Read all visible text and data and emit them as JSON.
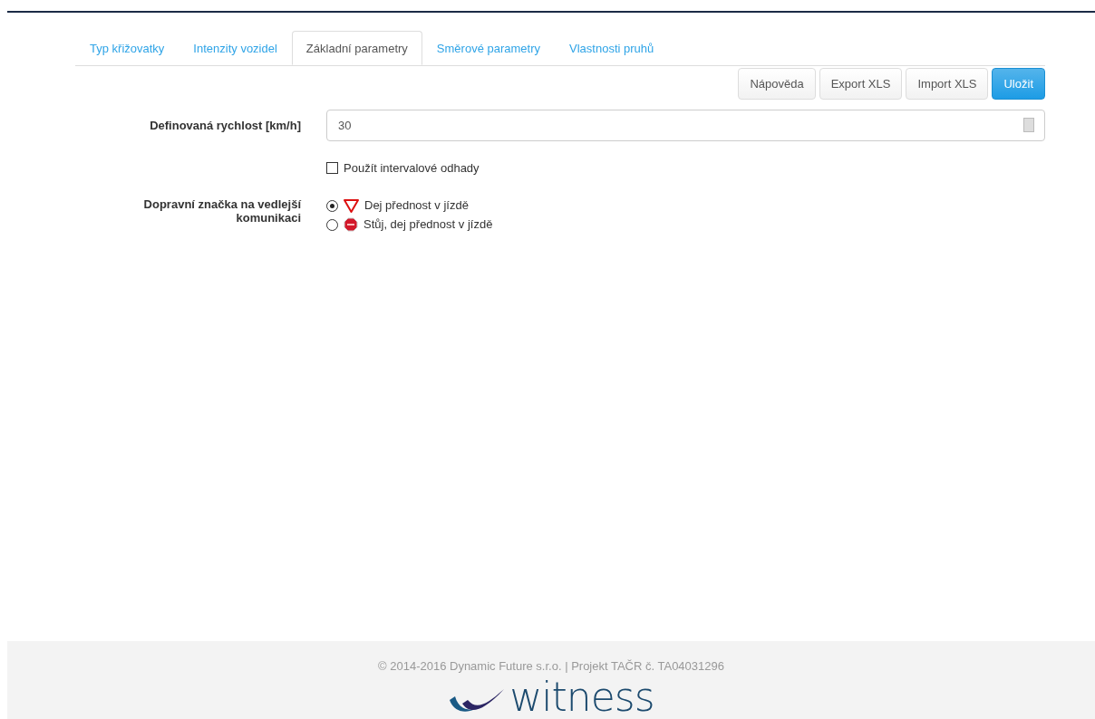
{
  "tabs": [
    {
      "label": "Typ křižovatky",
      "selected": false
    },
    {
      "label": "Intenzity vozidel",
      "selected": false
    },
    {
      "label": "Základní parametry",
      "selected": true
    },
    {
      "label": "Směrové parametry",
      "selected": false
    },
    {
      "label": "Vlastnosti pruhů",
      "selected": false
    }
  ],
  "buttons": [
    {
      "label": "Nápověda",
      "kind": "default"
    },
    {
      "label": "Export XLS",
      "kind": "default"
    },
    {
      "label": "Import XLS",
      "kind": "default"
    },
    {
      "label": "Uložit",
      "kind": "primary"
    }
  ],
  "speed": {
    "label": "Definovaná rychlost [km/h]",
    "value": "30"
  },
  "interval_estimates": {
    "label": "Použít intervalové odhady",
    "checked": false
  },
  "sign": {
    "label": "Dopravní značka na vedlejší komunikaci",
    "options": [
      {
        "label": "Dej přednost v jízdě",
        "kind": "yield",
        "selected": true
      },
      {
        "label": "Stůj, dej přednost v jízdě",
        "kind": "stop",
        "selected": false
      }
    ]
  },
  "footer": {
    "copyright": "© 2014-2016 Dynamic Future s.r.o. | Projekt TAČR č. TA04031296",
    "logo": "witness"
  }
}
